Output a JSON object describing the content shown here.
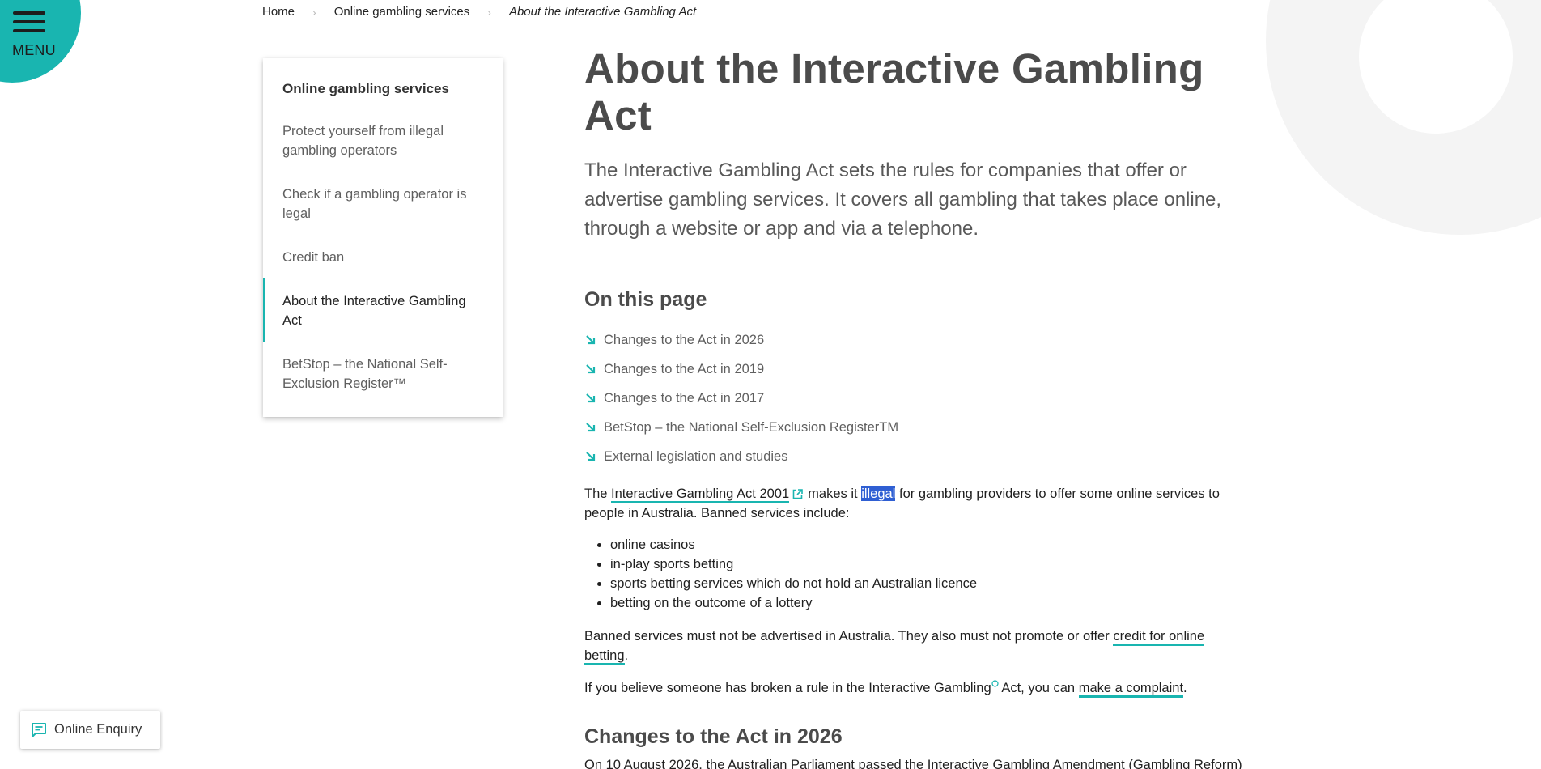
{
  "menu": {
    "label": "MENU"
  },
  "breadcrumb": {
    "home": "Home",
    "section": "Online gambling services",
    "current": "About the Interactive Gambling Act"
  },
  "sidebar": {
    "heading": "Online gambling services",
    "items": [
      {
        "label": "Protect yourself from illegal gambling operators"
      },
      {
        "label": "Check if a gambling operator is legal"
      },
      {
        "label": "Credit ban"
      },
      {
        "label": "About the Interactive Gambling Act"
      },
      {
        "label": "BetStop – the National Self-Exclusion Register™"
      }
    ]
  },
  "main": {
    "title": "About the Interactive Gambling Act",
    "lead": "The Interactive Gambling Act sets the rules for companies that offer or advertise gambling services. It covers all gambling that takes place online, through a website or app and via a telephone.",
    "on_this_page_heading": "On this page",
    "toc": [
      "Changes to the Act in 2026",
      "Changes to the Act in 2019",
      "Changes to the Act in 2017",
      "BetStop – the National Self-Exclusion RegisterTM",
      "External legislation and studies"
    ],
    "para1": {
      "pre": "The",
      "link": "Interactive Gambling Act 2001",
      "mid": "makes it",
      "highlight": "illegal",
      "post": "for gambling providers to offer some online services to people in Australia. Banned services include:"
    },
    "bullets": [
      "online casinos",
      "in-play sports betting",
      "sports betting services which do not hold an Australian licence",
      "betting on the outcome of a lottery"
    ],
    "para2": {
      "pre": "Banned services must not be advertised in Australia. They also must not promote or offer",
      "link": "credit for online betting",
      "post": "."
    },
    "para3": {
      "pre": "If you believe someone has broken a rule in the Interactive Gambling",
      "mid": "Act, you can",
      "link": "make a complaint",
      "post": "."
    },
    "section_heading": "Changes to the Act in 2026",
    "cut_text": "On 10 August 2026, the Australian Parliament passed the Interactive Gambling Amendment (Gambling Reform)"
  },
  "enquiry": {
    "label": "Online Enquiry"
  },
  "colors": {
    "accent": "#19b5b0",
    "selection": "#2f5fd3"
  }
}
